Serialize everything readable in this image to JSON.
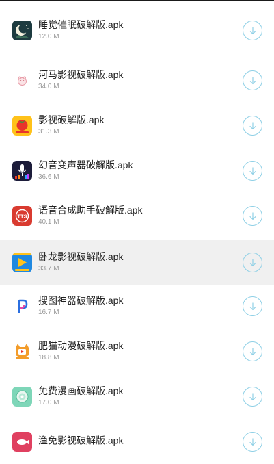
{
  "files": [
    {
      "name": "睡觉催眠破解版.apk",
      "size": "12.0 M",
      "icon": "moon-sleep-icon"
    },
    {
      "name": "河马影视破解版.apk",
      "size": "34.0 M",
      "icon": "hippo-icon"
    },
    {
      "name": "影视破解版.apk",
      "size": "31.3 M",
      "icon": "tomato-icon"
    },
    {
      "name": "幻音变声器破解版.apk",
      "size": "36.6 M",
      "icon": "microphone-icon"
    },
    {
      "name": "语音合成助手破解版.apk",
      "size": "40.1 M",
      "icon": "tts-icon"
    },
    {
      "name": "卧龙影视破解版.apk",
      "size": "33.7 M",
      "icon": "play-icon"
    },
    {
      "name": "搜图神器破解版.apk",
      "size": "16.7 M",
      "icon": "pinterest-p-icon"
    },
    {
      "name": "肥猫动漫破解版.apk",
      "size": "18.8 M",
      "icon": "cat-icon"
    },
    {
      "name": "免费漫画破解版.apk",
      "size": "17.0 M",
      "icon": "comic-icon"
    },
    {
      "name": "渔免影视破解版.apk",
      "size": "",
      "icon": "fish-icon"
    }
  ],
  "highlighted_index": 5,
  "colors": {
    "download_ring": "#8fd0e6",
    "row_highlight": "#f0f0f0",
    "text_primary": "#222222",
    "text_secondary": "#9a9a9a"
  }
}
